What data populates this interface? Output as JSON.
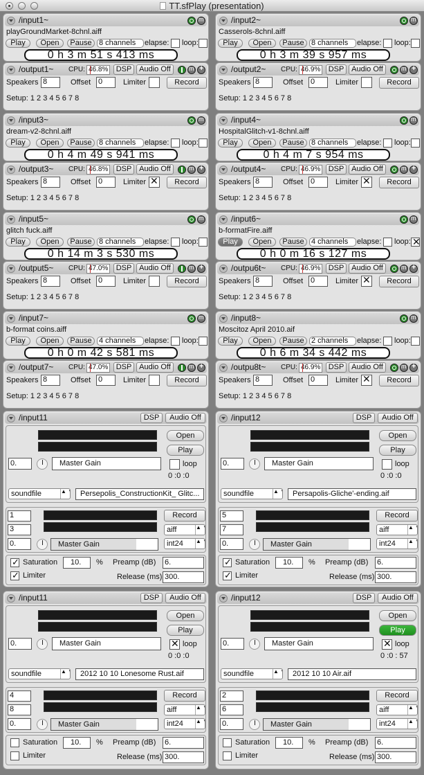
{
  "window": {
    "title": "TT.sfPlay (presentation)"
  },
  "common": {
    "play": "Play",
    "open": "Open",
    "pause": "Pause",
    "elapse": "elapse:",
    "loop": "loop:",
    "cpu": "CPU:",
    "dsp": "DSP",
    "audio_off": "Audio Off",
    "speakers": "Speakers",
    "offset": "Offset",
    "limiter": "Limiter",
    "record": "Record",
    "setup": "Setup: 1 2 3 4 5 6 7 8",
    "loop2": "loop",
    "master_gain": "Master Gain",
    "soundfile": "soundfile",
    "aiff": "aiff",
    "int24": "int24",
    "saturation": "Saturation",
    "pct": "%",
    "preamp": "Preamp (dB)",
    "release": "Release (ms)"
  },
  "players": [
    {
      "input": "/input1~",
      "file": "playGroundMarket-8chnl.aiff",
      "channels": "8 channels",
      "time": "0 h 3  m 51 s 413  ms",
      "output": "/output1~",
      "cpu": "46.8%",
      "speakers": "8",
      "offset": "0",
      "limiter": false
    },
    {
      "input": "/input2~",
      "file": "Casserols-8chnl.aiff",
      "channels": "8 channels",
      "time": "0 h 3  m 39 s 957  ms",
      "output": "/output2~",
      "cpu": "46.9%",
      "speakers": "8",
      "offset": "0",
      "limiter": false
    },
    {
      "input": "/input3~",
      "file": "dream-v2-8chnl.aiff",
      "channels": "8 channels",
      "time": "0 h 4  m 49 s 941  ms",
      "output": "/output3~",
      "cpu": "46.8%",
      "speakers": "8",
      "offset": "0",
      "limiter": true
    },
    {
      "input": "/input4~",
      "file": "HospitalGlitch-v1-8chnl.aiff",
      "channels": "8 channels",
      "time": "0 h 4  m 7  s 954  ms",
      "output": "/output4~",
      "cpu": "46.9%",
      "speakers": "8",
      "offset": "0",
      "limiter": true
    },
    {
      "input": "/input5~",
      "file": "glitch fuck.aiff",
      "channels": "8 channels",
      "time": "0 h 14 m 3  s 530  ms",
      "output": "/output5~",
      "cpu": "47.0%",
      "speakers": "8",
      "offset": "0",
      "limiter": false
    },
    {
      "input": "/input6~",
      "file": "b-formatFire.aiff",
      "channels": "4 channels",
      "time": "0 h 0  m 16 s 127  ms",
      "output": "/outpu6t~",
      "cpu": "46.9%",
      "speakers": "8",
      "offset": "0",
      "limiter": true
    },
    {
      "input": "/input7~",
      "file": "b-format coins.aiff",
      "channels": "4 channels",
      "time": "0 h 0  m 42 s 581  ms",
      "output": "/output7~",
      "cpu": "47.0%",
      "speakers": "8",
      "offset": "0",
      "limiter": false
    },
    {
      "input": "/input8~",
      "file": "Moscitoz April 2010.aif",
      "channels": "2 channels",
      "time": "0 h 6  m 34 s 442  ms",
      "output": "/outpu8t~",
      "cpu": "46.9%",
      "speakers": "8",
      "offset": "0",
      "limiter": true
    }
  ],
  "big": [
    {
      "input": "/input11",
      "gain": "0.",
      "counter": "0 :0 :0",
      "file": "Persepolis_ConstructionKit_ Glitc...",
      "ch1": "1",
      "ch2": "3",
      "rgain": "0.",
      "sat": "10.",
      "preamp": "6.",
      "release": "300.",
      "loop": false,
      "playing": false,
      "sat_on": true,
      "lim_on": true
    },
    {
      "input": "/input12",
      "gain": "0.",
      "counter": "0 :0 :0",
      "file": "Persapolis-Gliche'-ending.aif",
      "ch1": "5",
      "ch2": "7",
      "rgain": "0.",
      "sat": "10.",
      "preamp": "6.",
      "release": "300.",
      "loop": false,
      "playing": false,
      "sat_on": true,
      "lim_on": true
    },
    {
      "input": "/input11",
      "gain": "0.",
      "counter": "0 :0 :0",
      "file": "2012 10 10 Lonesome Rust.aif",
      "ch1": "4",
      "ch2": "8",
      "rgain": "0.",
      "sat": "10.",
      "preamp": "6.",
      "release": "300.",
      "loop": true,
      "playing": false,
      "sat_on": false,
      "lim_on": false
    },
    {
      "input": "/input12",
      "gain": "0.",
      "counter": "0 :0 : 57",
      "file": "2012 10 10 Air.aif",
      "ch1": "2",
      "ch2": "6",
      "rgain": "0.",
      "sat": "10.",
      "preamp": "6.",
      "release": "300.",
      "loop": true,
      "playing": true,
      "sat_on": false,
      "lim_on": false
    }
  ]
}
